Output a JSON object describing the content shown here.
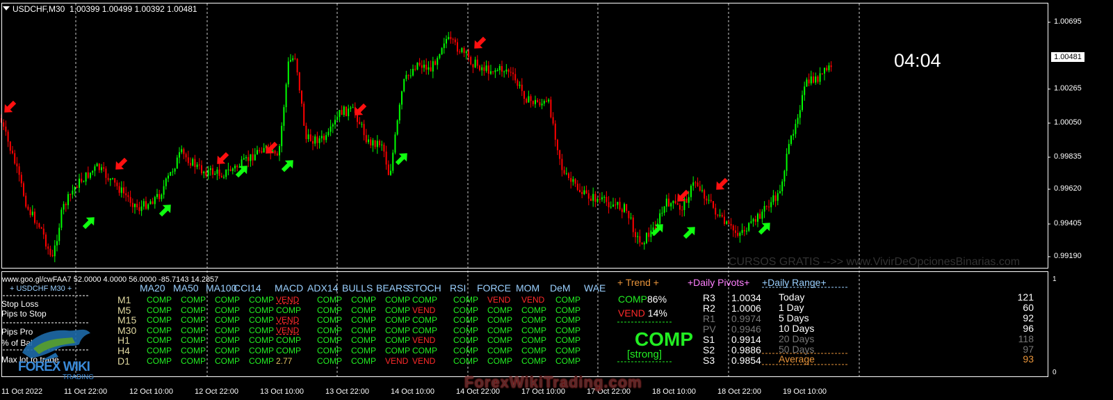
{
  "header": {
    "symbol_tf": "USDCHF,M30",
    "ohlc": "1.00399 1.00499 1.00392 1.00481"
  },
  "clock": "04:04",
  "price_axis": [
    "1.00695",
    "1.00481",
    "1.00265",
    "1.00050",
    "0.99835",
    "0.99620",
    "0.99405",
    "0.99190"
  ],
  "current_price": "1.00481",
  "time_axis": [
    "11 Oct 2022",
    "11 Oct 22:00",
    "12 Oct 10:00",
    "12 Oct 22:00",
    "13 Oct 10:00",
    "13 Oct 22:00",
    "14 Oct 10:00",
    "14 Oct 22:00",
    "17 Oct 10:00",
    "17 Oct 22:00",
    "18 Oct 10:00",
    "18 Oct 22:00",
    "19 Oct 10:00"
  ],
  "subwindow": {
    "url_line": "www.goo.gl/cwFAA7 52.0000 4.0000 56.0000 -85.7143 14.2857",
    "symbol_line": "+ USDCHF M30 +",
    "scale_top": "1",
    "scale_bottom": "0"
  },
  "left_panel": {
    "stop_loss": "Stop Loss",
    "pips_to_stop": "Pips to Stop",
    "pips_profit": "Pips Pro",
    "pct_balance": "% of Bal",
    "max_lot": "Max lot to trade"
  },
  "indicators": [
    "MA20",
    "MA50",
    "MA100",
    "CCI14",
    "MACD",
    "ADX14",
    "BULLS",
    "BEARS",
    "STOCH",
    "RSI",
    "FORCE",
    "MOM",
    "DeM",
    "WAE"
  ],
  "timeframes": [
    "M1",
    "M5",
    "M15",
    "M30",
    "H1",
    "H4",
    "D1"
  ],
  "grid": [
    [
      "COMP",
      "COMP",
      "COMP",
      "COMP",
      "VEND",
      "COMP",
      "COMP",
      "COMP",
      "COMP",
      "COMP",
      "VEND",
      "VEND",
      "COMP"
    ],
    [
      "COMP",
      "COMP",
      "COMP",
      "COMP",
      "COMP",
      "COMP",
      "COMP",
      "COMP",
      "VEND",
      "COMP",
      "COMP",
      "COMP",
      "COMP"
    ],
    [
      "COMP",
      "COMP",
      "COMP",
      "COMP",
      "VEND",
      "COMP",
      "COMP",
      "COMP",
      "COMP",
      "COMP",
      "COMP",
      "COMP",
      "COMP"
    ],
    [
      "COMP",
      "COMP",
      "COMP",
      "COMP",
      "VEND",
      "COMP",
      "COMP",
      "COMP",
      "COMP",
      "COMP",
      "COMP",
      "COMP",
      "COMP"
    ],
    [
      "COMP",
      "COMP",
      "COMP",
      "COMP",
      "COMP",
      "COMP",
      "COMP",
      "COMP",
      "VEND",
      "COMP",
      "COMP",
      "COMP",
      "COMP"
    ],
    [
      "COMP",
      "COMP",
      "COMP",
      "COMP",
      "COMP",
      "COMP",
      "COMP",
      "COMP",
      "COMP",
      "COMP",
      "COMP",
      "COMP",
      "COMP"
    ],
    [
      "COMP",
      "COMP",
      "COMP",
      "COMP",
      "2.77",
      "COMP",
      "COMP",
      "VEND",
      "VEND",
      "COMP",
      "COMP",
      "COMP",
      "COMP"
    ]
  ],
  "trend": {
    "header": "+ Trend +",
    "comp_label": "COMP",
    "comp_pct": "86%",
    "vend_label": "VEND",
    "vend_pct": "14%",
    "signal": "COMP",
    "strength": "[strong]"
  },
  "pivots": {
    "header": "+Daily Pivots+",
    "rows": [
      {
        "name": "R3",
        "value": "1.0034"
      },
      {
        "name": "R2",
        "value": "1.0006"
      },
      {
        "name": "R1",
        "value": "0.9974"
      },
      {
        "name": "PV",
        "value": "0.9946"
      },
      {
        "name": "S1",
        "value": "0.9914"
      },
      {
        "name": "S2",
        "value": "0.9886"
      },
      {
        "name": "S3",
        "value": "0.9854"
      }
    ]
  },
  "daily_range": {
    "header": "+Daily Range+",
    "rows": [
      {
        "name": "Today",
        "value": "121"
      },
      {
        "name": "1 Day",
        "value": "60"
      },
      {
        "name": "5 Days",
        "value": "92"
      },
      {
        "name": "10 Days",
        "value": "96"
      },
      {
        "name": "20 Days",
        "value": "118"
      },
      {
        "name": "50 Days",
        "value": "97"
      },
      {
        "name": "Average",
        "value": "93"
      }
    ]
  },
  "watermark": "CURSOS GRATIS -->> www.VivirDeOpcionesBinarias.com",
  "site_watermark": "ForexWikiTrading.com",
  "logo_text": "FOREX WIKI",
  "logo_sub": "TRADING",
  "colors": {
    "bull": "#00ff00",
    "bear": "#ff0000",
    "grid": "#ffffff",
    "background": "#000000"
  }
}
